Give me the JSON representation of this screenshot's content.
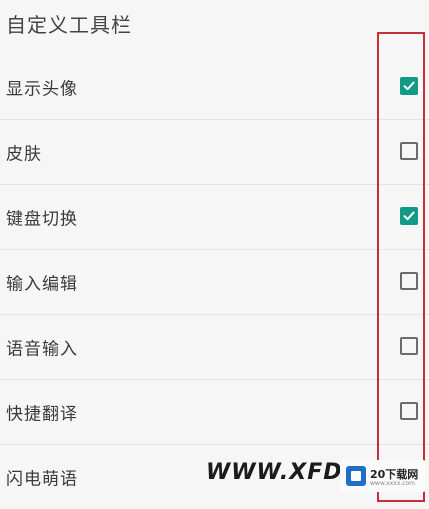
{
  "header": {
    "title": "自定义工具栏"
  },
  "toolbar_items": [
    {
      "label": "显示头像",
      "checked": true
    },
    {
      "label": "皮肤",
      "checked": false
    },
    {
      "label": "键盘切换",
      "checked": true
    },
    {
      "label": "输入编辑",
      "checked": false
    },
    {
      "label": "语音输入",
      "checked": false
    },
    {
      "label": "快捷翻译",
      "checked": false
    },
    {
      "label": "闪电萌语",
      "checked": null
    }
  ],
  "colors": {
    "checked": "#139a86",
    "unchecked_border": "#6b6b6b",
    "highlight_box": "#c72e3a"
  },
  "icons": {
    "checked": "check-icon"
  },
  "watermark": {
    "text": "WWW.XFDOW",
    "badge_name": "20下载网",
    "badge_url": "www.xxxx.com"
  }
}
